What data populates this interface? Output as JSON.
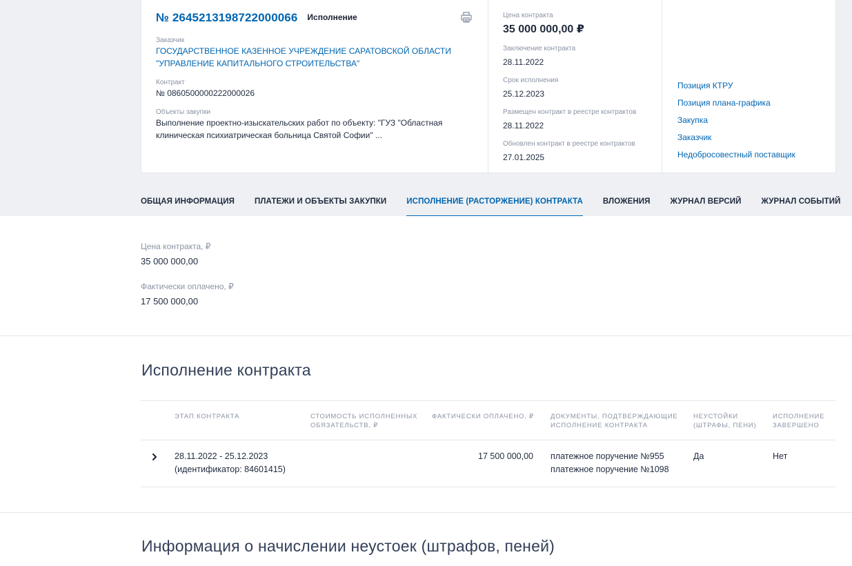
{
  "header": {
    "reg_number": "№ 2645213198722000066",
    "status": "Исполнение",
    "customer_label": "Заказчик",
    "customer_line1": "ГОСУДАРСТВЕННОЕ КАЗЕННОЕ УЧРЕЖДЕНИЕ САРАТОВСКОЙ ОБЛАСТИ",
    "customer_line2": "\"УПРАВЛЕНИЕ КАПИТАЛЬНОГО СТРОИТЕЛЬСТВА\"",
    "contract_label": "Контракт",
    "contract_value": "№ 0860500000222000026",
    "objects_label": "Объекты закупки",
    "objects_line1": "Выполнение проектно-изыскательских работ по объекту: \"ГУЗ \"Областная",
    "objects_line2": "клиническая психиатрическая больница Святой Софии\" ..."
  },
  "details": {
    "price_label": "Цена контракта",
    "price_value": "35 000 000,00 ₽",
    "conclusion_label": "Заключение контракта",
    "conclusion_value": "28.11.2022",
    "term_label": "Срок исполнения",
    "term_value": "25.12.2023",
    "placed_label": "Размещен контракт в реестре контрактов",
    "placed_value": "28.11.2022",
    "updated_label": "Обновлен контракт в реестре контрактов",
    "updated_value": "27.01.2025"
  },
  "side_links": [
    "Позиция КТРУ",
    "Позиция плана-графика",
    "Закупка",
    "Заказчик",
    "Недобросовестный поставщик"
  ],
  "tabs": [
    {
      "label": "ОБЩАЯ ИНФОРМАЦИЯ",
      "active": false
    },
    {
      "label": "ПЛАТЕЖИ И ОБЪЕКТЫ ЗАКУПКИ",
      "active": false
    },
    {
      "label": "ИСПОЛНЕНИЕ (РАСТОРЖЕНИЕ) КОНТРАКТА",
      "active": true
    },
    {
      "label": "ВЛОЖЕНИЯ",
      "active": false
    },
    {
      "label": "ЖУРНАЛ ВЕРСИЙ",
      "active": false
    },
    {
      "label": "ЖУРНАЛ СОБЫТИЙ",
      "active": false
    }
  ],
  "summary": {
    "price_label": "Цена контракта, ₽",
    "price_value": "35 000 000,00",
    "paid_label": "Фактически оплачено, ₽",
    "paid_value": "17 500 000,00"
  },
  "execution": {
    "title": "Исполнение контракта",
    "headers": {
      "stage_1": "ЭТАП КОНТРАКТА",
      "cost_1": "СТОИМОСТЬ ИСПОЛНЕННЫХ",
      "cost_2": "ОБЯЗАТЕЛЬСТВ, ₽",
      "paid_1": "ФАКТИЧЕСКИ ОПЛАЧЕНО, ₽",
      "docs_1": "ДОКУМЕНТЫ, ПОДТВЕРЖДАЮЩИЕ",
      "docs_2": "ИСПОЛНЕНИЕ КОНТРАКТА",
      "penalty_1": "НЕУСТОЙКИ",
      "penalty_2": "(ШТРАФЫ, ПЕНИ)",
      "done_1": "ИСПОЛНЕНИЕ",
      "done_2": "ЗАВЕРШЕНО"
    },
    "row": {
      "stage_1": "28.11.2022 - 25.12.2023",
      "stage_2": "(идентификатор: 84601415)",
      "cost": "",
      "paid": "17 500 000,00",
      "doc_1": "платежное поручение №955",
      "doc_2": "платежное поручение №1098",
      "penalty": "Да",
      "done": "Нет"
    }
  },
  "penalties": {
    "title": "Информация о начислении неустоек (штрафов, пеней)"
  },
  "colors": {
    "link": "#0065b1",
    "band": "#eef0f3",
    "border": "#e3e6ec"
  }
}
